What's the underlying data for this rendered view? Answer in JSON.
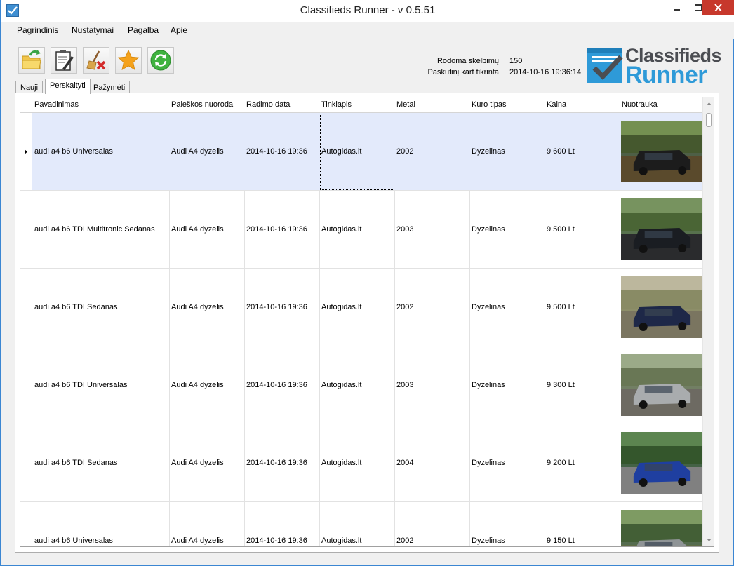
{
  "window": {
    "title": "Classifieds Runner - v 0.5.51"
  },
  "menu": [
    "Pagrindinis",
    "Nustatymai",
    "Pagalba",
    "Apie"
  ],
  "toolbar": {
    "buttons": [
      "open-folder-icon",
      "clipboard-edit-icon",
      "broom-delete-icon",
      "star-icon",
      "refresh-icon"
    ]
  },
  "info": {
    "shown_label": "Rodoma skelbimų",
    "shown_value": "150",
    "checked_label": "Paskutinį kart tikrinta",
    "checked_value": "2014-10-16 19:36:14"
  },
  "logo": {
    "line1": "Classifieds",
    "line2": "Runner"
  },
  "tabs": [
    "Nauji",
    "Perskaityti",
    "Pažymėti"
  ],
  "active_tab": "Perskaityti",
  "grid": {
    "columns": [
      "Pavadinimas",
      "Paieškos nuoroda",
      "Radimo data",
      "Tinklapis",
      "Metai",
      "Kuro tipas",
      "Kaina",
      "Nuotrauka"
    ],
    "rows": [
      {
        "name": "audi a4 b6 Universalas",
        "search": "Audi A4 dyzelis",
        "date": "2014-10-16 19:36",
        "site": "Autogidas.lt",
        "year": "2002",
        "fuel": "Dyzelinas",
        "price": "9 600  Lt"
      },
      {
        "name": "audi a4 b6 TDI Multitronic Sedanas",
        "search": "Audi A4 dyzelis",
        "date": "2014-10-16 19:36",
        "site": "Autogidas.lt",
        "year": "2003",
        "fuel": "Dyzelinas",
        "price": "9 500  Lt"
      },
      {
        "name": "audi a4 b6 TDI Sedanas",
        "search": "Audi A4 dyzelis",
        "date": "2014-10-16 19:36",
        "site": "Autogidas.lt",
        "year": "2002",
        "fuel": "Dyzelinas",
        "price": "9 500  Lt"
      },
      {
        "name": "audi a4 b6 TDI Universalas",
        "search": "Audi A4 dyzelis",
        "date": "2014-10-16 19:36",
        "site": "Autogidas.lt",
        "year": "2003",
        "fuel": "Dyzelinas",
        "price": "9 300  Lt"
      },
      {
        "name": "audi a4 b6 TDI Sedanas",
        "search": "Audi A4 dyzelis",
        "date": "2014-10-16 19:36",
        "site": "Autogidas.lt",
        "year": "2004",
        "fuel": "Dyzelinas",
        "price": "9 200  Lt"
      },
      {
        "name": "audi a4 b6 Universalas",
        "search": "Audi A4 dyzelis",
        "date": "2014-10-16 19:36",
        "site": "Autogidas.lt",
        "year": "2002",
        "fuel": "Dyzelinas",
        "price": "9 150  Lt"
      }
    ]
  },
  "colors": {
    "selected_row": "#e3eafb",
    "logo_gray": "#4b4d52",
    "logo_blue": "#2e9ad8",
    "close_button": "#c7382c"
  }
}
